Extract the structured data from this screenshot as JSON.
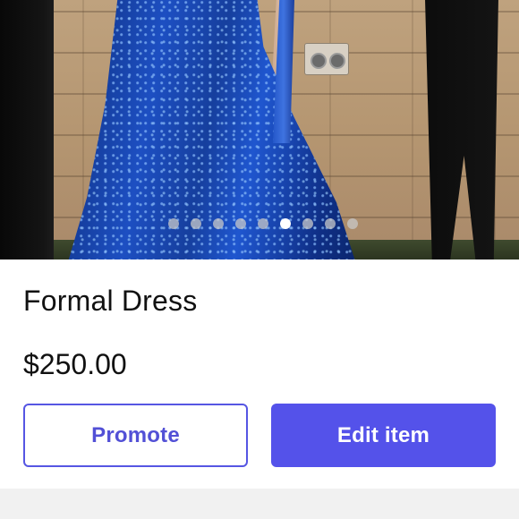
{
  "listing": {
    "title": "Formal Dress",
    "price": "$250.00"
  },
  "carousel": {
    "total_images": 9,
    "active_index": 5
  },
  "actions": {
    "promote_label": "Promote",
    "edit_label": "Edit item"
  },
  "colors": {
    "accent": "#5452ea",
    "text": "#111111",
    "footer": "#f1f1f1"
  }
}
